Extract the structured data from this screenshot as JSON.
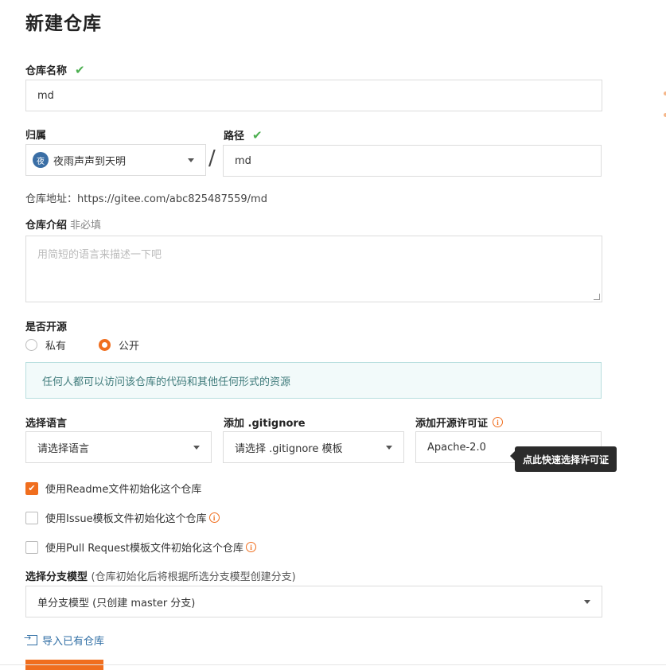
{
  "page": {
    "title": "新建仓库"
  },
  "repo_name": {
    "label": "仓库名称",
    "value": "md"
  },
  "owner": {
    "label": "归属",
    "avatar_text": "夜",
    "value": "夜雨声声到天明"
  },
  "path": {
    "label": "路径",
    "value": "md",
    "separator": "/"
  },
  "repo_url": {
    "label": "仓库地址：",
    "value": "https://gitee.com/abc825487559/md"
  },
  "description": {
    "label": "仓库介绍",
    "optional": "非必填",
    "placeholder": "用简短的语言来描述一下吧"
  },
  "visibility": {
    "label": "是否开源",
    "private_label": "私有",
    "public_label": "公开",
    "selected": "public",
    "public_hint": "任何人都可以访问该仓库的代码和其他任何形式的资源"
  },
  "language": {
    "label": "选择语言",
    "value": "请选择语言"
  },
  "gitignore": {
    "label": "添加 .gitignore",
    "value": "请选择 .gitignore 模板"
  },
  "license": {
    "label": "添加开源许可证",
    "value": "Apache-2.0",
    "tooltip": "点此快速选择许可证"
  },
  "init_options": [
    {
      "label": "使用Readme文件初始化这个仓库",
      "checked": true,
      "info": false
    },
    {
      "label": "使用Issue模板文件初始化这个仓库",
      "checked": false,
      "info": true
    },
    {
      "label": "使用Pull Request模板文件初始化这个仓库",
      "checked": false,
      "info": true
    }
  ],
  "branch_model": {
    "label": "选择分支模型",
    "note": "(仓库初始化后将根据所选分支模型创建分支)",
    "value": "单分支模型 (只创建 master 分支)"
  },
  "import_link": {
    "label": "导入已有仓库"
  },
  "colors": {
    "accent": "#f06e1e",
    "success": "#4caf50",
    "link": "#2f6ea4"
  }
}
